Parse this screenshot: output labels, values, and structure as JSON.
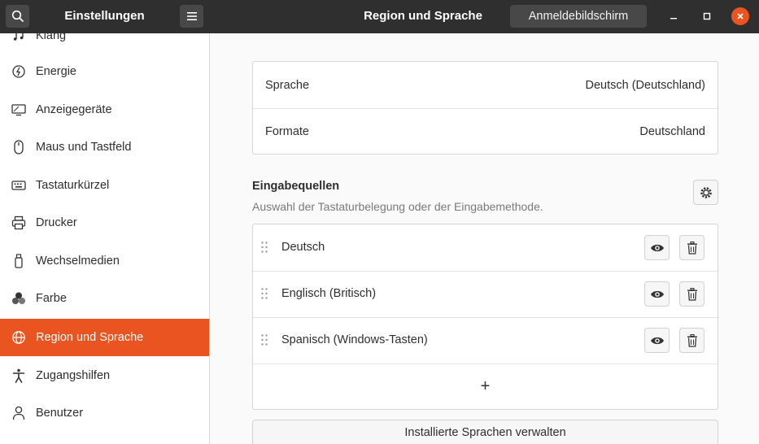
{
  "header": {
    "app_title": "Einstellungen",
    "page_title": "Region und Sprache",
    "login_screen_button": "Anmeldebildschirm"
  },
  "sidebar": {
    "items": [
      {
        "label": "Klang",
        "icon": "music-note-icon"
      },
      {
        "label": "Energie",
        "icon": "power-icon"
      },
      {
        "label": "Anzeigegeräte",
        "icon": "display-icon"
      },
      {
        "label": "Maus und Tastfeld",
        "icon": "mouse-icon"
      },
      {
        "label": "Tastaturkürzel",
        "icon": "keyboard-icon"
      },
      {
        "label": "Drucker",
        "icon": "printer-icon"
      },
      {
        "label": "Wechselmedien",
        "icon": "usb-drive-icon"
      },
      {
        "label": "Farbe",
        "icon": "color-icon"
      },
      {
        "label": "Region und Sprache",
        "icon": "globe-icon",
        "active": true
      },
      {
        "label": "Zugangshilfen",
        "icon": "accessibility-icon"
      },
      {
        "label": "Benutzer",
        "icon": "user-icon"
      }
    ]
  },
  "language": {
    "label": "Sprache",
    "value": "Deutsch (Deutschland)"
  },
  "formats": {
    "label": "Formate",
    "value": "Deutschland"
  },
  "input_sources": {
    "title": "Eingabequellen",
    "subtitle": "Auswahl der Tastaturbelegung oder der Eingabemethode.",
    "items": [
      "Deutsch",
      "Englisch (Britisch)",
      "Spanisch (Windows-Tasten)"
    ],
    "add_label": "+"
  },
  "manage_languages_button": "Installierte Sprachen verwalten",
  "colors": {
    "accent": "#e95420",
    "header": "#2f2f2f"
  }
}
